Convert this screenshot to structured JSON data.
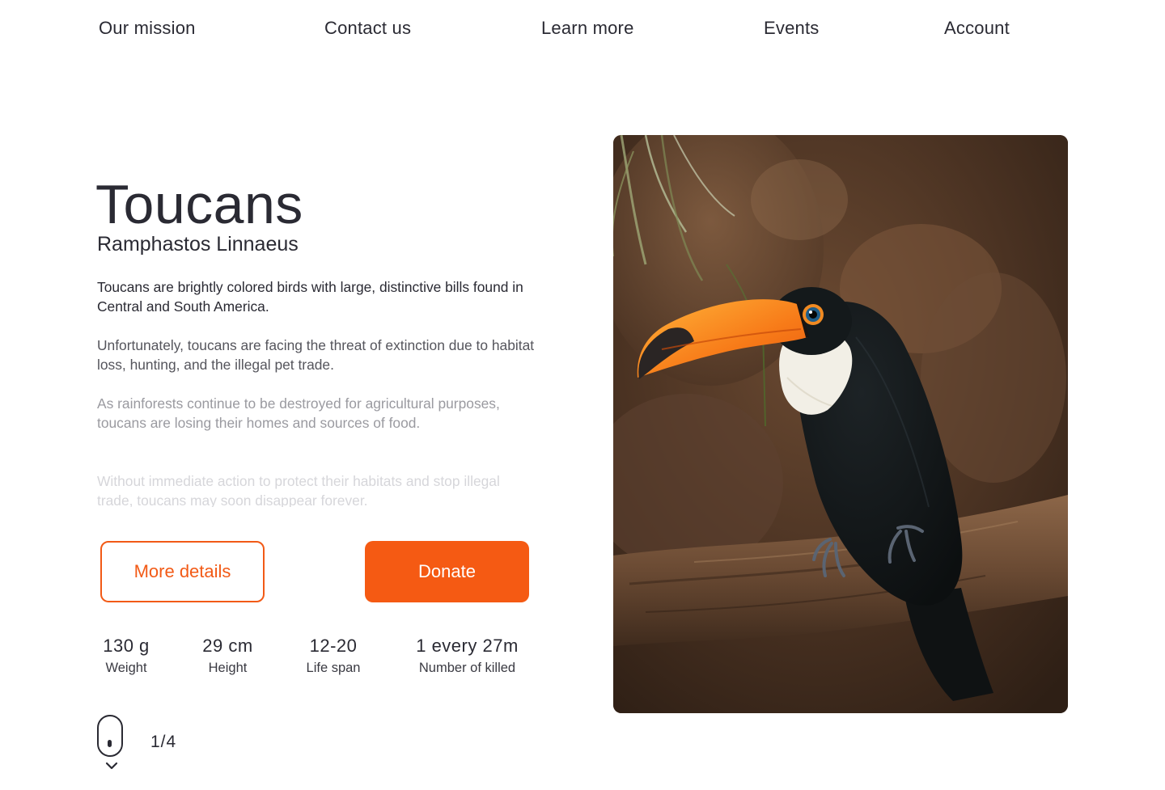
{
  "nav": {
    "items": [
      "Our mission",
      "Contact us",
      "Learn more",
      "Events",
      "Account"
    ]
  },
  "hero": {
    "title": "Toucans",
    "subtitle": "Ramphastos Linnaeus",
    "paragraphs": [
      "Toucans are brightly colored birds with large, distinctive bills found in Central and South America.",
      "Unfortunately, toucans are facing the threat of extinction due to habitat loss, hunting, and the illegal pet trade.",
      "As rainforests continue to be destroyed for agricultural purposes, toucans are losing their homes and sources of food.",
      "Without immediate action to protect their habitats and stop illegal trade, toucans may soon disappear forever."
    ],
    "buttons": {
      "details": "More details",
      "donate": "Donate"
    }
  },
  "stats": [
    {
      "value": "130 g",
      "label": "Weight"
    },
    {
      "value": "29 cm",
      "label": "Height"
    },
    {
      "value": "12-20",
      "label": "Life span"
    },
    {
      "value": "1 every 27m",
      "label": "Number of killed"
    }
  ],
  "pager": {
    "text": "1/4"
  },
  "image": {
    "icon": "toucan-photo",
    "subject": "toucan perched on branch"
  },
  "colors": {
    "accent": "#f55a13",
    "text": "#2a2a33"
  }
}
